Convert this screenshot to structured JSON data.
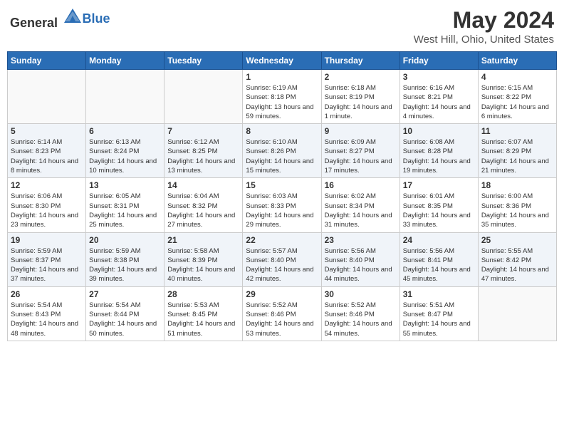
{
  "header": {
    "logo_general": "General",
    "logo_blue": "Blue",
    "title": "May 2024",
    "subtitle": "West Hill, Ohio, United States"
  },
  "days_of_week": [
    "Sunday",
    "Monday",
    "Tuesday",
    "Wednesday",
    "Thursday",
    "Friday",
    "Saturday"
  ],
  "weeks": [
    {
      "stripe": 1,
      "days": [
        {
          "num": "",
          "empty": true,
          "sunrise": "",
          "sunset": "",
          "daylight": ""
        },
        {
          "num": "",
          "empty": true,
          "sunrise": "",
          "sunset": "",
          "daylight": ""
        },
        {
          "num": "",
          "empty": true,
          "sunrise": "",
          "sunset": "",
          "daylight": ""
        },
        {
          "num": "1",
          "empty": false,
          "sunrise": "Sunrise: 6:19 AM",
          "sunset": "Sunset: 8:18 PM",
          "daylight": "Daylight: 13 hours and 59 minutes."
        },
        {
          "num": "2",
          "empty": false,
          "sunrise": "Sunrise: 6:18 AM",
          "sunset": "Sunset: 8:19 PM",
          "daylight": "Daylight: 14 hours and 1 minute."
        },
        {
          "num": "3",
          "empty": false,
          "sunrise": "Sunrise: 6:16 AM",
          "sunset": "Sunset: 8:21 PM",
          "daylight": "Daylight: 14 hours and 4 minutes."
        },
        {
          "num": "4",
          "empty": false,
          "sunrise": "Sunrise: 6:15 AM",
          "sunset": "Sunset: 8:22 PM",
          "daylight": "Daylight: 14 hours and 6 minutes."
        }
      ]
    },
    {
      "stripe": 2,
      "days": [
        {
          "num": "5",
          "empty": false,
          "sunrise": "Sunrise: 6:14 AM",
          "sunset": "Sunset: 8:23 PM",
          "daylight": "Daylight: 14 hours and 8 minutes."
        },
        {
          "num": "6",
          "empty": false,
          "sunrise": "Sunrise: 6:13 AM",
          "sunset": "Sunset: 8:24 PM",
          "daylight": "Daylight: 14 hours and 10 minutes."
        },
        {
          "num": "7",
          "empty": false,
          "sunrise": "Sunrise: 6:12 AM",
          "sunset": "Sunset: 8:25 PM",
          "daylight": "Daylight: 14 hours and 13 minutes."
        },
        {
          "num": "8",
          "empty": false,
          "sunrise": "Sunrise: 6:10 AM",
          "sunset": "Sunset: 8:26 PM",
          "daylight": "Daylight: 14 hours and 15 minutes."
        },
        {
          "num": "9",
          "empty": false,
          "sunrise": "Sunrise: 6:09 AM",
          "sunset": "Sunset: 8:27 PM",
          "daylight": "Daylight: 14 hours and 17 minutes."
        },
        {
          "num": "10",
          "empty": false,
          "sunrise": "Sunrise: 6:08 AM",
          "sunset": "Sunset: 8:28 PM",
          "daylight": "Daylight: 14 hours and 19 minutes."
        },
        {
          "num": "11",
          "empty": false,
          "sunrise": "Sunrise: 6:07 AM",
          "sunset": "Sunset: 8:29 PM",
          "daylight": "Daylight: 14 hours and 21 minutes."
        }
      ]
    },
    {
      "stripe": 1,
      "days": [
        {
          "num": "12",
          "empty": false,
          "sunrise": "Sunrise: 6:06 AM",
          "sunset": "Sunset: 8:30 PM",
          "daylight": "Daylight: 14 hours and 23 minutes."
        },
        {
          "num": "13",
          "empty": false,
          "sunrise": "Sunrise: 6:05 AM",
          "sunset": "Sunset: 8:31 PM",
          "daylight": "Daylight: 14 hours and 25 minutes."
        },
        {
          "num": "14",
          "empty": false,
          "sunrise": "Sunrise: 6:04 AM",
          "sunset": "Sunset: 8:32 PM",
          "daylight": "Daylight: 14 hours and 27 minutes."
        },
        {
          "num": "15",
          "empty": false,
          "sunrise": "Sunrise: 6:03 AM",
          "sunset": "Sunset: 8:33 PM",
          "daylight": "Daylight: 14 hours and 29 minutes."
        },
        {
          "num": "16",
          "empty": false,
          "sunrise": "Sunrise: 6:02 AM",
          "sunset": "Sunset: 8:34 PM",
          "daylight": "Daylight: 14 hours and 31 minutes."
        },
        {
          "num": "17",
          "empty": false,
          "sunrise": "Sunrise: 6:01 AM",
          "sunset": "Sunset: 8:35 PM",
          "daylight": "Daylight: 14 hours and 33 minutes."
        },
        {
          "num": "18",
          "empty": false,
          "sunrise": "Sunrise: 6:00 AM",
          "sunset": "Sunset: 8:36 PM",
          "daylight": "Daylight: 14 hours and 35 minutes."
        }
      ]
    },
    {
      "stripe": 2,
      "days": [
        {
          "num": "19",
          "empty": false,
          "sunrise": "Sunrise: 5:59 AM",
          "sunset": "Sunset: 8:37 PM",
          "daylight": "Daylight: 14 hours and 37 minutes."
        },
        {
          "num": "20",
          "empty": false,
          "sunrise": "Sunrise: 5:59 AM",
          "sunset": "Sunset: 8:38 PM",
          "daylight": "Daylight: 14 hours and 39 minutes."
        },
        {
          "num": "21",
          "empty": false,
          "sunrise": "Sunrise: 5:58 AM",
          "sunset": "Sunset: 8:39 PM",
          "daylight": "Daylight: 14 hours and 40 minutes."
        },
        {
          "num": "22",
          "empty": false,
          "sunrise": "Sunrise: 5:57 AM",
          "sunset": "Sunset: 8:40 PM",
          "daylight": "Daylight: 14 hours and 42 minutes."
        },
        {
          "num": "23",
          "empty": false,
          "sunrise": "Sunrise: 5:56 AM",
          "sunset": "Sunset: 8:40 PM",
          "daylight": "Daylight: 14 hours and 44 minutes."
        },
        {
          "num": "24",
          "empty": false,
          "sunrise": "Sunrise: 5:56 AM",
          "sunset": "Sunset: 8:41 PM",
          "daylight": "Daylight: 14 hours and 45 minutes."
        },
        {
          "num": "25",
          "empty": false,
          "sunrise": "Sunrise: 5:55 AM",
          "sunset": "Sunset: 8:42 PM",
          "daylight": "Daylight: 14 hours and 47 minutes."
        }
      ]
    },
    {
      "stripe": 1,
      "days": [
        {
          "num": "26",
          "empty": false,
          "sunrise": "Sunrise: 5:54 AM",
          "sunset": "Sunset: 8:43 PM",
          "daylight": "Daylight: 14 hours and 48 minutes."
        },
        {
          "num": "27",
          "empty": false,
          "sunrise": "Sunrise: 5:54 AM",
          "sunset": "Sunset: 8:44 PM",
          "daylight": "Daylight: 14 hours and 50 minutes."
        },
        {
          "num": "28",
          "empty": false,
          "sunrise": "Sunrise: 5:53 AM",
          "sunset": "Sunset: 8:45 PM",
          "daylight": "Daylight: 14 hours and 51 minutes."
        },
        {
          "num": "29",
          "empty": false,
          "sunrise": "Sunrise: 5:52 AM",
          "sunset": "Sunset: 8:46 PM",
          "daylight": "Daylight: 14 hours and 53 minutes."
        },
        {
          "num": "30",
          "empty": false,
          "sunrise": "Sunrise: 5:52 AM",
          "sunset": "Sunset: 8:46 PM",
          "daylight": "Daylight: 14 hours and 54 minutes."
        },
        {
          "num": "31",
          "empty": false,
          "sunrise": "Sunrise: 5:51 AM",
          "sunset": "Sunset: 8:47 PM",
          "daylight": "Daylight: 14 hours and 55 minutes."
        },
        {
          "num": "",
          "empty": true,
          "sunrise": "",
          "sunset": "",
          "daylight": ""
        }
      ]
    }
  ]
}
